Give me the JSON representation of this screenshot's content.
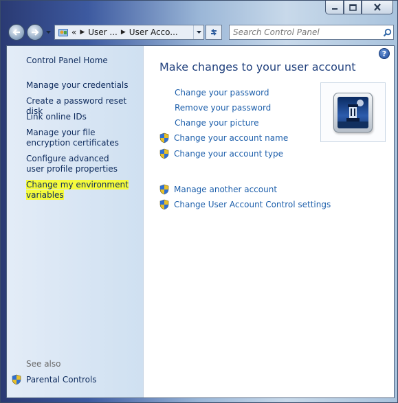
{
  "address_bar": {
    "overflow": "«",
    "segments": [
      "User ...",
      "User Acco..."
    ]
  },
  "search": {
    "placeholder": "Search Control Panel"
  },
  "left_pane": {
    "home": "Control Panel Home",
    "tasks": [
      "Manage your credentials",
      "Create a password reset disk",
      "Link online IDs",
      "Manage your file encryption certificates",
      "Configure advanced user profile properties",
      "Change my environment variables"
    ],
    "see_also": {
      "heading": "See also",
      "items": [
        "Parental Controls"
      ]
    }
  },
  "main": {
    "help": "?",
    "title": "Make changes to your user account",
    "links": [
      "Change your password",
      "Remove your password",
      "Change your picture"
    ],
    "shield_links": [
      "Change your account name",
      "Change your account type"
    ],
    "other_links": [
      "Manage another account",
      "Change User Account Control settings"
    ]
  },
  "colors": {
    "link": "#1d5fab",
    "task_link": "#0d2a5c",
    "title": "#1f3f7c",
    "highlight": "#f5fb3c"
  },
  "icons": {
    "minimize": "minimize-icon",
    "maximize": "maximize-icon",
    "close": "close-icon",
    "back": "back-arrow-icon",
    "forward": "forward-arrow-icon",
    "refresh": "refresh-icon",
    "search": "search-icon",
    "shield": "uac-shield-icon",
    "help": "help-icon"
  }
}
